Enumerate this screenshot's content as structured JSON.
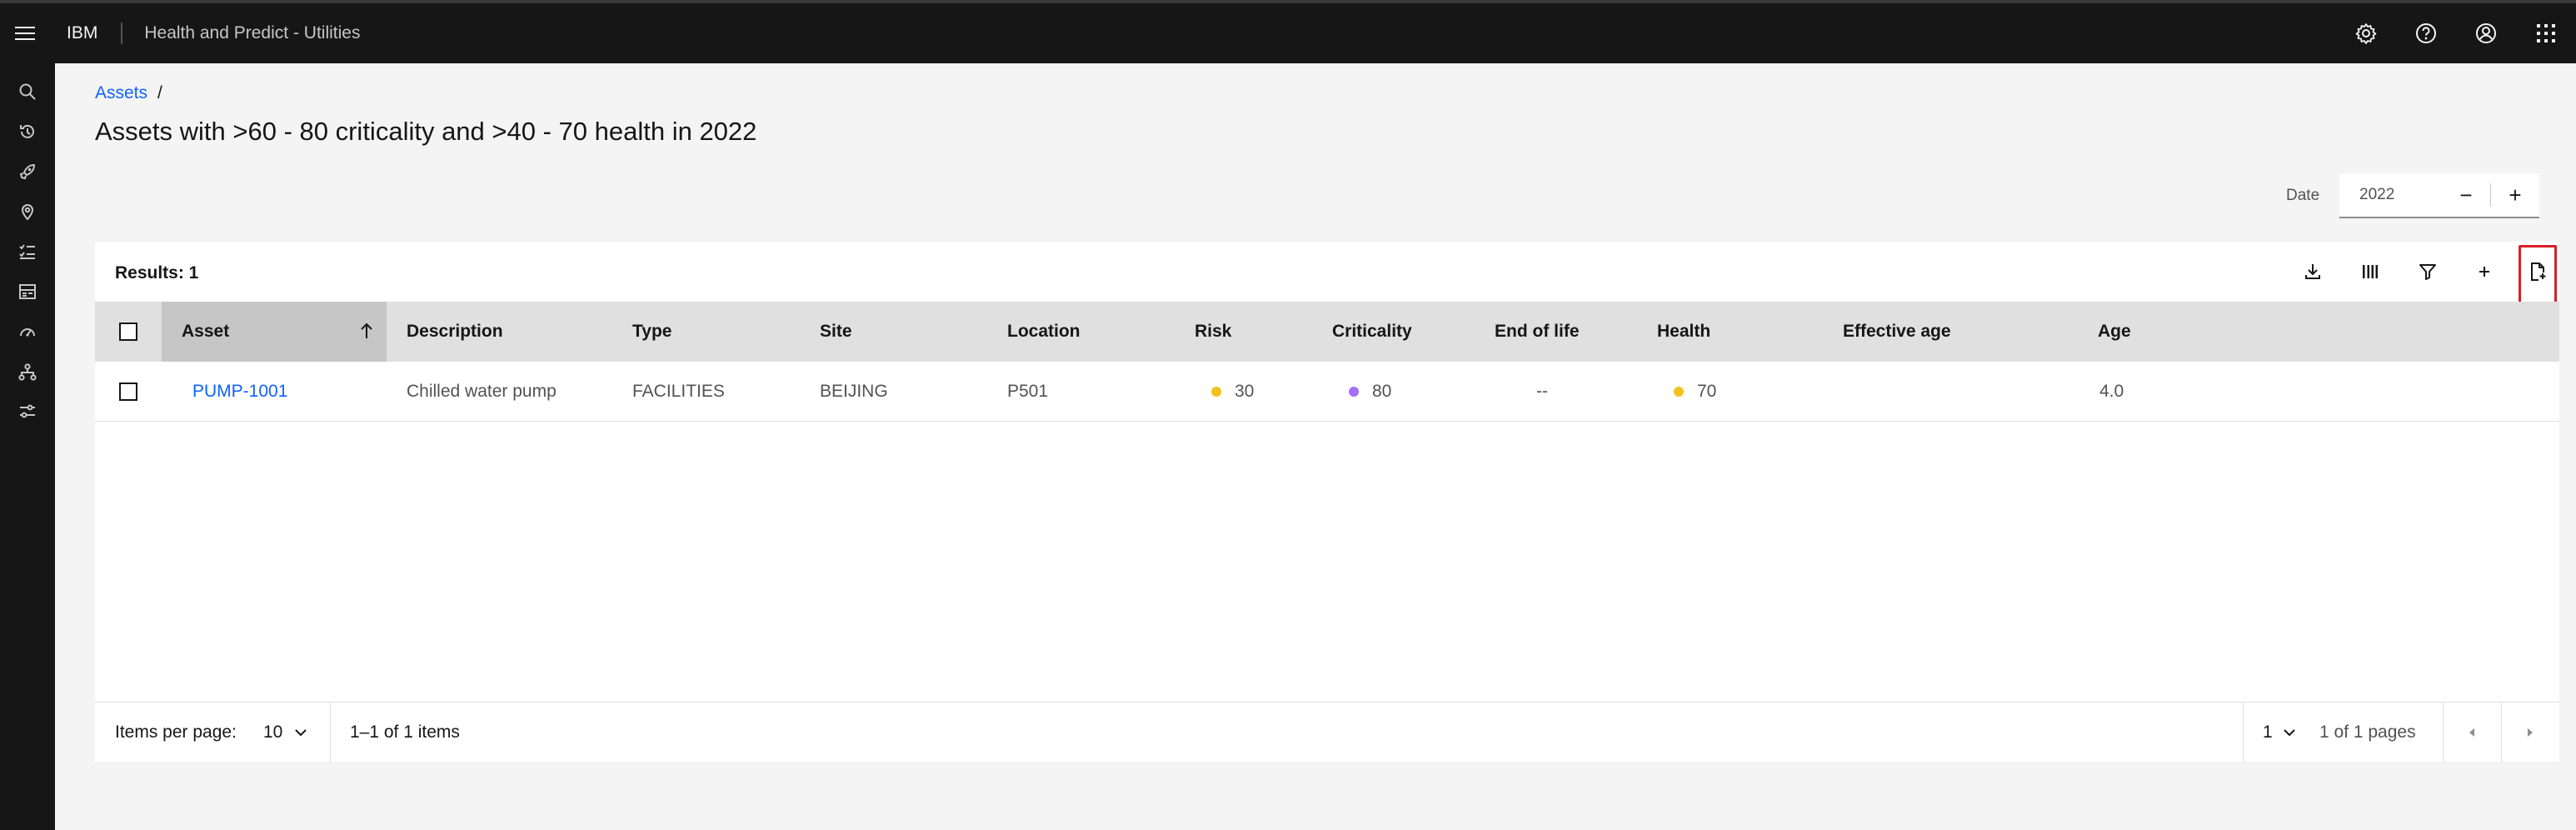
{
  "header": {
    "brand": "IBM",
    "product": "Health and Predict - Utilities",
    "icons": [
      "menu-icon",
      "settings-icon",
      "help-icon",
      "user-icon",
      "app-switcher-icon"
    ]
  },
  "rail": {
    "icons": [
      "search-icon",
      "recent-icon",
      "rocket-icon",
      "location-icon",
      "checklist-icon",
      "dashboard-icon",
      "speedometer-icon",
      "hierarchy-icon",
      "sliders-icon"
    ]
  },
  "breadcrumb": {
    "link": "Assets",
    "separator": "/"
  },
  "page_title": "Assets with >60 - 80 criticality and >40 - 70 health in 2022",
  "date": {
    "label": "Date",
    "value": "2022",
    "decrement": "−",
    "increment": "+"
  },
  "table": {
    "results": "Results: 1",
    "toolbar_icons": [
      "download-icon",
      "columns-icon",
      "filter-icon",
      "add-icon",
      "export-document-icon"
    ],
    "columns": {
      "asset": "Asset",
      "description": "Description",
      "type": "Type",
      "site": "Site",
      "location": "Location",
      "risk": "Risk",
      "criticality": "Criticality",
      "end_of_life": "End of life",
      "health": "Health",
      "effective_age": "Effective age",
      "age": "Age"
    },
    "rows": [
      {
        "asset": "PUMP-1001",
        "description": "Chilled water pump",
        "type": "FACILITIES",
        "site": "BEIJING",
        "location": "P501",
        "risk": "30",
        "criticality": "80",
        "end_of_life": "--",
        "health": "70",
        "effective_age": "",
        "age": "4.0"
      }
    ],
    "status_colors": {
      "risk": "#f1c21b",
      "criticality": "#a56eff",
      "health": "#f1c21b"
    }
  },
  "pagination": {
    "items_per_page_label": "Items per page:",
    "items_per_page": "10",
    "range": "1–1 of 1 items",
    "page": "1",
    "pages": "1 of 1 pages"
  },
  "colors": {
    "accent": "#0f62fe",
    "highlight": "#da1e28"
  }
}
